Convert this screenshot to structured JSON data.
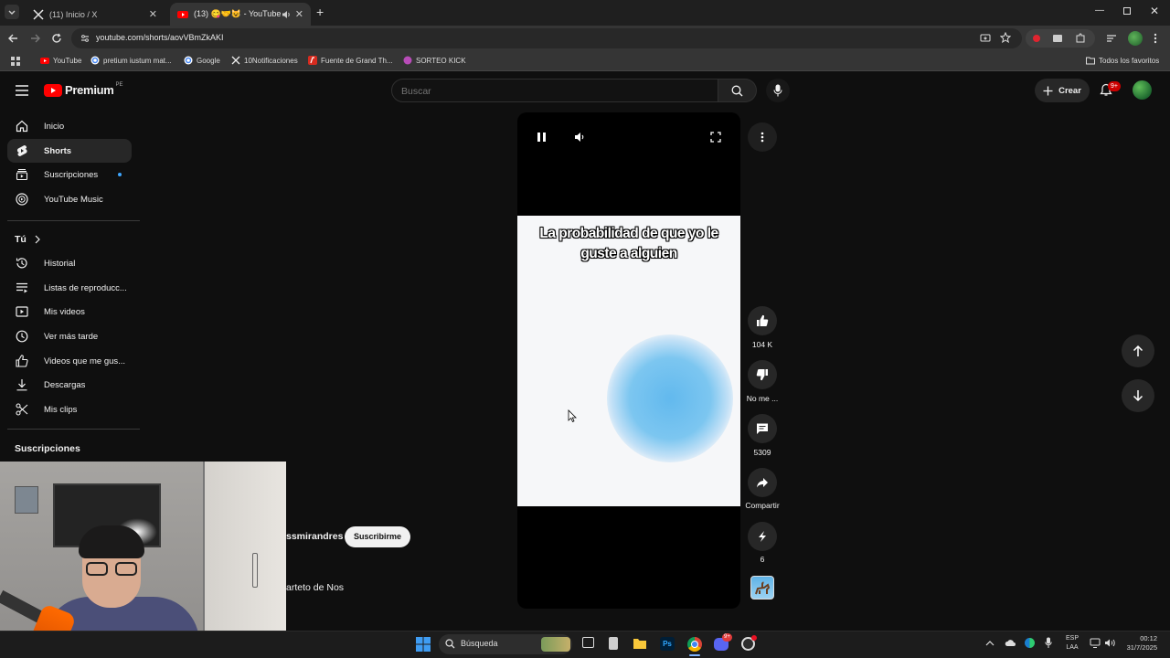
{
  "browser": {
    "tabs": [
      {
        "title": "(11) Inicio / X",
        "active": false
      },
      {
        "title": "(13) 😋🤝😺 - YouTube",
        "active": true
      }
    ],
    "url": "youtube.com/shorts/aovVBmZkAKI",
    "bookmarks": [
      "YouTube",
      "pretium iustum mat...",
      "Google",
      "10Notificaciones",
      "Fuente de Grand Th...",
      "SORTEO KICK"
    ],
    "all_bookmarks": "Todos los favoritos"
  },
  "youtube": {
    "logo_text": "Premium",
    "logo_badge": "PE",
    "search_placeholder": "Buscar",
    "create_label": "Crear",
    "notif_count": "9+",
    "nav_main": [
      "Inicio",
      "Shorts",
      "Suscripciones",
      "YouTube Music"
    ],
    "you_label": "Tú",
    "nav_you": [
      "Historial",
      "Listas de reproducc...",
      "Mis videos",
      "Ver más tarde",
      "Videos que me gus...",
      "Descargas",
      "Mis clips"
    ],
    "subs_heading": "Suscripciones",
    "channel_partial": "ssmirandres",
    "subscribe_label": "Suscribirme",
    "sound_partial": "arteto de Nos"
  },
  "short": {
    "caption": "La probabilidad de que yo le guste a alguien",
    "likes": "104 K",
    "dislike_label": "No me ...",
    "comments": "5309",
    "share_label": "Compartir",
    "remix_count": "6"
  },
  "taskbar": {
    "search": "Búsqueda",
    "lang_top": "ESP",
    "lang_bottom": "LAA",
    "time": "00:12",
    "date": "31/7/2025",
    "discord_badge": "9+"
  }
}
